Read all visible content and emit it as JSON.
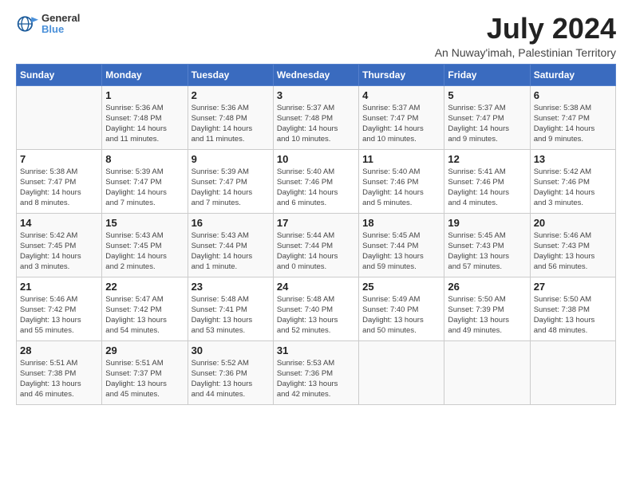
{
  "logo": {
    "line1": "General",
    "line2": "Blue"
  },
  "title": "July 2024",
  "subtitle": "An Nuway'imah, Palestinian Territory",
  "headers": [
    "Sunday",
    "Monday",
    "Tuesday",
    "Wednesday",
    "Thursday",
    "Friday",
    "Saturday"
  ],
  "weeks": [
    [
      {
        "day": "",
        "lines": []
      },
      {
        "day": "1",
        "lines": [
          "Sunrise: 5:36 AM",
          "Sunset: 7:48 PM",
          "Daylight: 14 hours",
          "and 11 minutes."
        ]
      },
      {
        "day": "2",
        "lines": [
          "Sunrise: 5:36 AM",
          "Sunset: 7:48 PM",
          "Daylight: 14 hours",
          "and 11 minutes."
        ]
      },
      {
        "day": "3",
        "lines": [
          "Sunrise: 5:37 AM",
          "Sunset: 7:48 PM",
          "Daylight: 14 hours",
          "and 10 minutes."
        ]
      },
      {
        "day": "4",
        "lines": [
          "Sunrise: 5:37 AM",
          "Sunset: 7:47 PM",
          "Daylight: 14 hours",
          "and 10 minutes."
        ]
      },
      {
        "day": "5",
        "lines": [
          "Sunrise: 5:37 AM",
          "Sunset: 7:47 PM",
          "Daylight: 14 hours",
          "and 9 minutes."
        ]
      },
      {
        "day": "6",
        "lines": [
          "Sunrise: 5:38 AM",
          "Sunset: 7:47 PM",
          "Daylight: 14 hours",
          "and 9 minutes."
        ]
      }
    ],
    [
      {
        "day": "7",
        "lines": [
          "Sunrise: 5:38 AM",
          "Sunset: 7:47 PM",
          "Daylight: 14 hours",
          "and 8 minutes."
        ]
      },
      {
        "day": "8",
        "lines": [
          "Sunrise: 5:39 AM",
          "Sunset: 7:47 PM",
          "Daylight: 14 hours",
          "and 7 minutes."
        ]
      },
      {
        "day": "9",
        "lines": [
          "Sunrise: 5:39 AM",
          "Sunset: 7:47 PM",
          "Daylight: 14 hours",
          "and 7 minutes."
        ]
      },
      {
        "day": "10",
        "lines": [
          "Sunrise: 5:40 AM",
          "Sunset: 7:46 PM",
          "Daylight: 14 hours",
          "and 6 minutes."
        ]
      },
      {
        "day": "11",
        "lines": [
          "Sunrise: 5:40 AM",
          "Sunset: 7:46 PM",
          "Daylight: 14 hours",
          "and 5 minutes."
        ]
      },
      {
        "day": "12",
        "lines": [
          "Sunrise: 5:41 AM",
          "Sunset: 7:46 PM",
          "Daylight: 14 hours",
          "and 4 minutes."
        ]
      },
      {
        "day": "13",
        "lines": [
          "Sunrise: 5:42 AM",
          "Sunset: 7:46 PM",
          "Daylight: 14 hours",
          "and 3 minutes."
        ]
      }
    ],
    [
      {
        "day": "14",
        "lines": [
          "Sunrise: 5:42 AM",
          "Sunset: 7:45 PM",
          "Daylight: 14 hours",
          "and 3 minutes."
        ]
      },
      {
        "day": "15",
        "lines": [
          "Sunrise: 5:43 AM",
          "Sunset: 7:45 PM",
          "Daylight: 14 hours",
          "and 2 minutes."
        ]
      },
      {
        "day": "16",
        "lines": [
          "Sunrise: 5:43 AM",
          "Sunset: 7:44 PM",
          "Daylight: 14 hours",
          "and 1 minute."
        ]
      },
      {
        "day": "17",
        "lines": [
          "Sunrise: 5:44 AM",
          "Sunset: 7:44 PM",
          "Daylight: 14 hours",
          "and 0 minutes."
        ]
      },
      {
        "day": "18",
        "lines": [
          "Sunrise: 5:45 AM",
          "Sunset: 7:44 PM",
          "Daylight: 13 hours",
          "and 59 minutes."
        ]
      },
      {
        "day": "19",
        "lines": [
          "Sunrise: 5:45 AM",
          "Sunset: 7:43 PM",
          "Daylight: 13 hours",
          "and 57 minutes."
        ]
      },
      {
        "day": "20",
        "lines": [
          "Sunrise: 5:46 AM",
          "Sunset: 7:43 PM",
          "Daylight: 13 hours",
          "and 56 minutes."
        ]
      }
    ],
    [
      {
        "day": "21",
        "lines": [
          "Sunrise: 5:46 AM",
          "Sunset: 7:42 PM",
          "Daylight: 13 hours",
          "and 55 minutes."
        ]
      },
      {
        "day": "22",
        "lines": [
          "Sunrise: 5:47 AM",
          "Sunset: 7:42 PM",
          "Daylight: 13 hours",
          "and 54 minutes."
        ]
      },
      {
        "day": "23",
        "lines": [
          "Sunrise: 5:48 AM",
          "Sunset: 7:41 PM",
          "Daylight: 13 hours",
          "and 53 minutes."
        ]
      },
      {
        "day": "24",
        "lines": [
          "Sunrise: 5:48 AM",
          "Sunset: 7:40 PM",
          "Daylight: 13 hours",
          "and 52 minutes."
        ]
      },
      {
        "day": "25",
        "lines": [
          "Sunrise: 5:49 AM",
          "Sunset: 7:40 PM",
          "Daylight: 13 hours",
          "and 50 minutes."
        ]
      },
      {
        "day": "26",
        "lines": [
          "Sunrise: 5:50 AM",
          "Sunset: 7:39 PM",
          "Daylight: 13 hours",
          "and 49 minutes."
        ]
      },
      {
        "day": "27",
        "lines": [
          "Sunrise: 5:50 AM",
          "Sunset: 7:38 PM",
          "Daylight: 13 hours",
          "and 48 minutes."
        ]
      }
    ],
    [
      {
        "day": "28",
        "lines": [
          "Sunrise: 5:51 AM",
          "Sunset: 7:38 PM",
          "Daylight: 13 hours",
          "and 46 minutes."
        ]
      },
      {
        "day": "29",
        "lines": [
          "Sunrise: 5:51 AM",
          "Sunset: 7:37 PM",
          "Daylight: 13 hours",
          "and 45 minutes."
        ]
      },
      {
        "day": "30",
        "lines": [
          "Sunrise: 5:52 AM",
          "Sunset: 7:36 PM",
          "Daylight: 13 hours",
          "and 44 minutes."
        ]
      },
      {
        "day": "31",
        "lines": [
          "Sunrise: 5:53 AM",
          "Sunset: 7:36 PM",
          "Daylight: 13 hours",
          "and 42 minutes."
        ]
      },
      {
        "day": "",
        "lines": []
      },
      {
        "day": "",
        "lines": []
      },
      {
        "day": "",
        "lines": []
      }
    ]
  ]
}
